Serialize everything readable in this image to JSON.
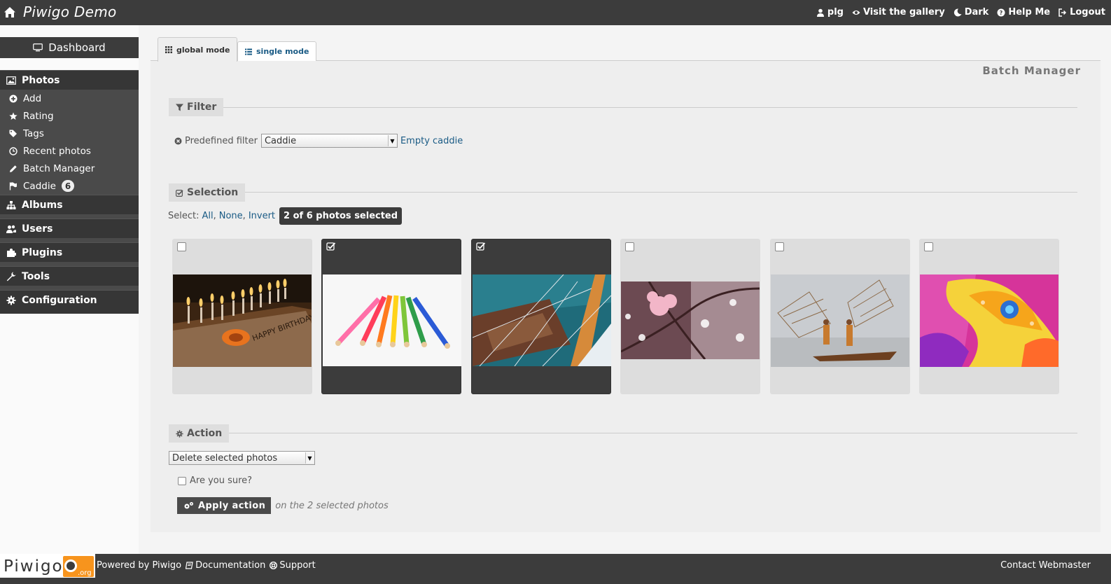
{
  "header": {
    "title": "Piwigo Demo",
    "links": [
      {
        "label": "plg",
        "icon": "user-icon"
      },
      {
        "label": "Visit the gallery",
        "icon": "eye-icon"
      },
      {
        "label": "Dark",
        "icon": "moon-icon"
      },
      {
        "label": "Help Me",
        "icon": "help-icon"
      },
      {
        "label": "Logout",
        "icon": "logout-icon"
      }
    ]
  },
  "sidebar": {
    "dashboard": "Dashboard",
    "photos": {
      "label": "Photos",
      "items": [
        {
          "label": "Add"
        },
        {
          "label": "Rating"
        },
        {
          "label": "Tags"
        },
        {
          "label": "Recent photos"
        },
        {
          "label": "Batch Manager"
        },
        {
          "label": "Caddie",
          "count": "6"
        }
      ]
    },
    "sections": [
      "Albums",
      "Users",
      "Plugins",
      "Tools",
      "Configuration"
    ]
  },
  "tabs": {
    "global": "global mode",
    "single": "single mode"
  },
  "page_title": "Batch Manager",
  "filter": {
    "legend": "Filter",
    "predefined_label": "Predefined filter",
    "predefined_value": "Caddie",
    "empty_link": "Empty caddie"
  },
  "selection": {
    "legend": "Selection",
    "select_label": "Select:",
    "all": "All",
    "none": "None",
    "invert": "Invert",
    "sep": ",",
    "badge": "2 of 6 photos selected",
    "photos": [
      {
        "subject": "birthday-cake",
        "selected": false
      },
      {
        "subject": "colored-pencils",
        "selected": true
      },
      {
        "subject": "sailing-ship",
        "selected": true
      },
      {
        "subject": "cherry-blossom",
        "selected": false
      },
      {
        "subject": "fishermen",
        "selected": false
      },
      {
        "subject": "carousel-horse",
        "selected": false
      }
    ]
  },
  "action": {
    "legend": "Action",
    "select_value": "Delete selected photos",
    "confirm_label": "Are you sure?",
    "apply_label": "Apply action",
    "apply_note": "on the 2 selected photos"
  },
  "footer": {
    "logo_text": "Piwigo",
    "logo_suffix": ".org",
    "powered": "Powered by Piwigo",
    "documentation": "Documentation",
    "support": "Support",
    "contact": "Contact Webmaster"
  },
  "colors": {
    "header_bg": "#3c3c3c",
    "link": "#1a5b85",
    "logo_orange": "#f7941d"
  }
}
